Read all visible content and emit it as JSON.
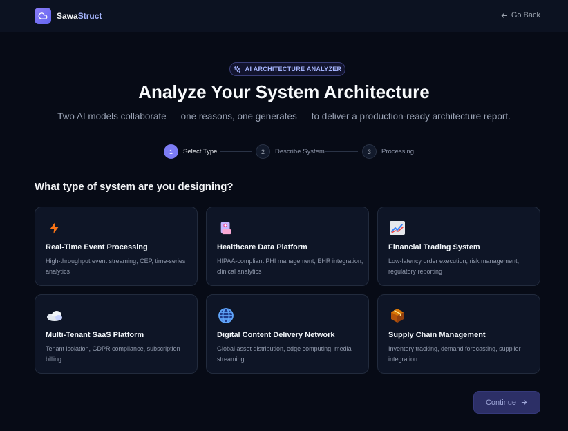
{
  "header": {
    "brand_part1": "Sawa",
    "brand_part2": "Struct",
    "go_back_label": "Go Back"
  },
  "hero": {
    "badge": "AI ARCHITECTURE ANALYZER",
    "title": "Analyze Your System Architecture",
    "subtitle": "Two AI models collaborate — one reasons, one generates — to deliver a production-ready architecture report."
  },
  "steps": [
    {
      "number": "1",
      "label": "Select Type",
      "active": true
    },
    {
      "number": "2",
      "label": "Describe System",
      "active": false
    },
    {
      "number": "3",
      "label": "Processing",
      "active": false
    }
  ],
  "question": "What type of system are you designing?",
  "cards": [
    {
      "icon": "lightning-icon",
      "title": "Real-Time Event Processing",
      "description": "High-throughput event streaming, CEP, time-series analytics"
    },
    {
      "icon": "medical-records-icon",
      "title": "Healthcare Data Platform",
      "description": "HIPAA-compliant PHI management, EHR integration, clinical analytics"
    },
    {
      "icon": "chart-trending-up-icon",
      "title": "Financial Trading System",
      "description": "Low-latency order execution, risk management, regulatory reporting"
    },
    {
      "icon": "cloud-icon",
      "title": "Multi-Tenant SaaS Platform",
      "description": "Tenant isolation, GDPR compliance, subscription billing"
    },
    {
      "icon": "globe-icon",
      "title": "Digital Content Delivery Network",
      "description": "Global asset distribution, edge computing, media streaming"
    },
    {
      "icon": "package-icon",
      "title": "Supply Chain Management",
      "description": "Inventory tracking, demand forecasting, supplier integration"
    }
  ],
  "footer": {
    "continue_label": "Continue"
  },
  "colors": {
    "background": "#070b16",
    "accent": "#7c7cf4",
    "card_bg": "#0e1526"
  }
}
